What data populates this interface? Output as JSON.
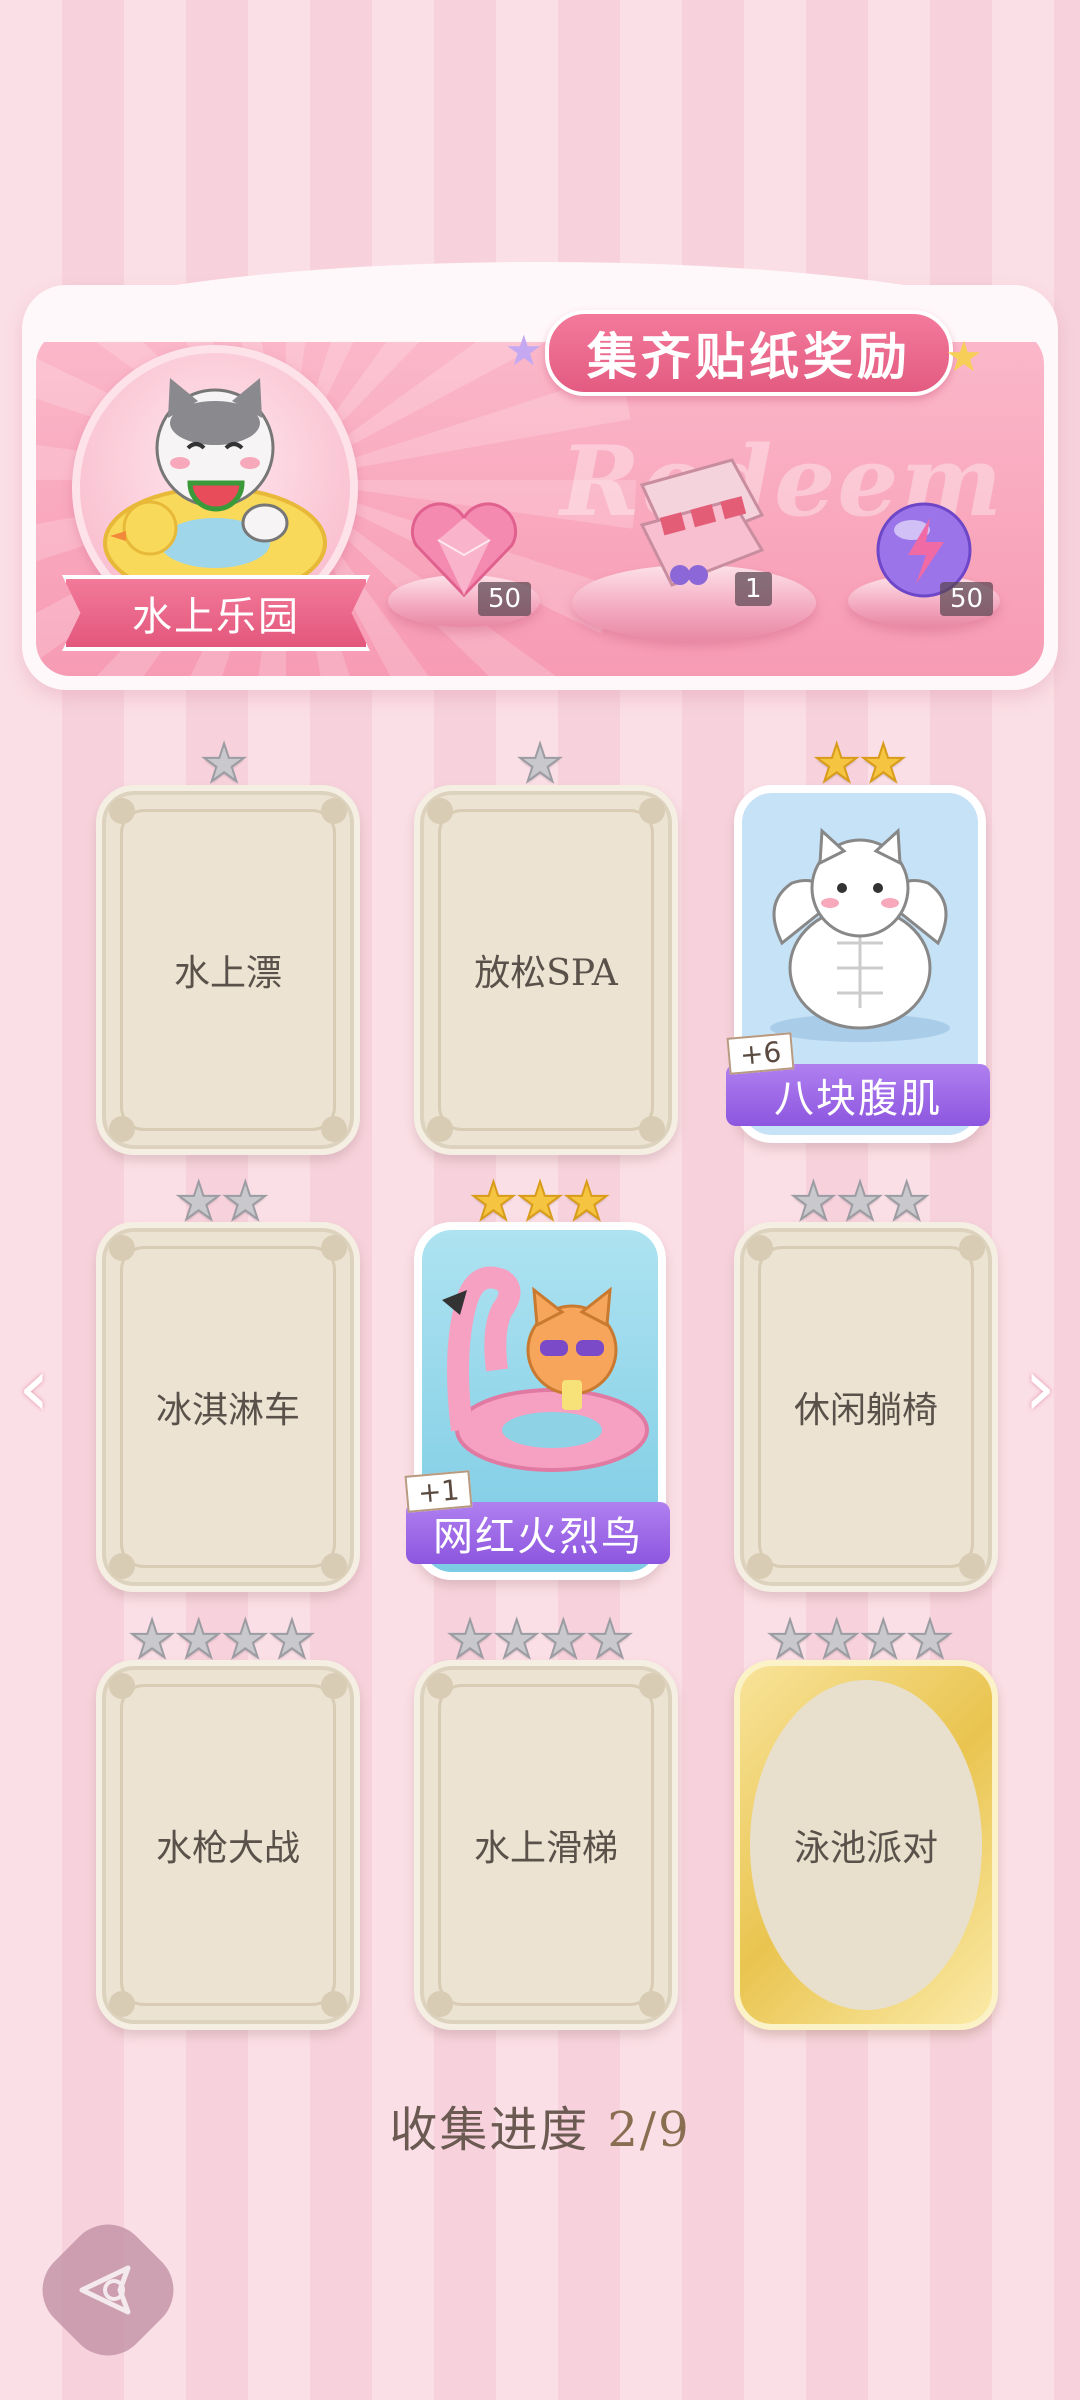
{
  "banner": {
    "title": "集齐贴纸奖励",
    "watermark": "Redeem",
    "theme_name": "水上乐园",
    "rewards": [
      {
        "icon": "pink-diamond-heart-icon",
        "count": "50"
      },
      {
        "icon": "gift-box-icon",
        "count": "1"
      },
      {
        "icon": "energy-orb-icon",
        "count": "50"
      }
    ]
  },
  "cards": [
    {
      "label": "水上漂",
      "stars": 1,
      "collected": false
    },
    {
      "label": "放松SPA",
      "stars": 1,
      "collected": false
    },
    {
      "label": "八块腹肌",
      "stars": 2,
      "collected": true,
      "plus": "+6"
    },
    {
      "label": "冰淇淋车",
      "stars": 2,
      "collected": false
    },
    {
      "label": "网红火烈鸟",
      "stars": 3,
      "collected": true,
      "plus": "+1"
    },
    {
      "label": "休闲躺椅",
      "stars": 3,
      "collected": false
    },
    {
      "label": "水枪大战",
      "stars": 4,
      "collected": false
    },
    {
      "label": "水上滑梯",
      "stars": 4,
      "collected": false
    },
    {
      "label": "泳池派对",
      "stars": 4,
      "collected": false,
      "special": "gold"
    }
  ],
  "progress": {
    "label": "收集进度",
    "value": "2/9"
  },
  "nav": {
    "prev": "‹",
    "next": "›"
  },
  "colors": {
    "ribbon": "#e35b81",
    "purple": "#8d56df",
    "gold": "#f5c542"
  }
}
